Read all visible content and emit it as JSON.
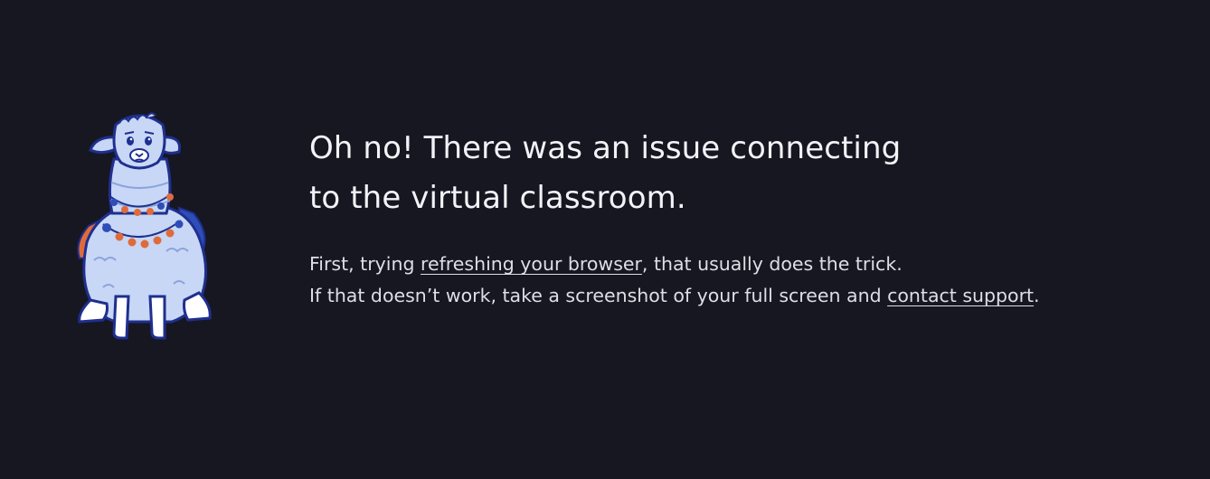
{
  "illustration": {
    "name": "llama-mascot",
    "colors": {
      "fur": "#c7d7f5",
      "outline": "#1f2f8f",
      "accent_orange": "#e06b3a",
      "accent_blue": "#2e4db8",
      "background": "#171722"
    }
  },
  "headline": {
    "line1": "Oh no! There was an issue connecting",
    "line2": "to the virtual classroom."
  },
  "instructions": {
    "line1_prefix": "First, trying ",
    "refresh_link": "refreshing your browser",
    "line1_suffix": ", that usually does the trick.",
    "line2_prefix": "If that doesn’t work, take a screenshot of your full screen and ",
    "support_link": "contact support",
    "line2_suffix": "."
  }
}
